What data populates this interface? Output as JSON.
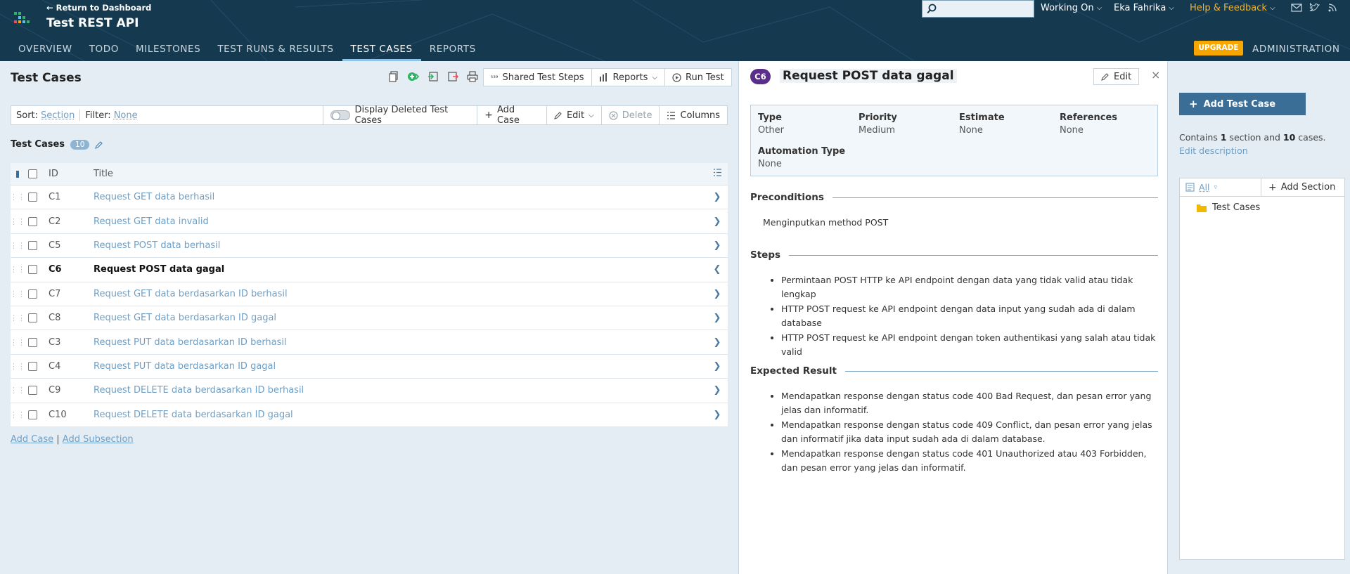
{
  "header": {
    "back_link": "← Return to Dashboard",
    "project_title": "Test REST API",
    "tabs": [
      "OVERVIEW",
      "TODO",
      "MILESTONES",
      "TEST RUNS & RESULTS",
      "TEST CASES",
      "REPORTS"
    ],
    "active_tab": "TEST CASES",
    "search_placeholder": "",
    "working_on": "Working On",
    "user_name": "Eka Fahrika",
    "help_label": "Help & Feedback",
    "upgrade_label": "UPGRADE",
    "admin_label": "ADMINISTRATION",
    "colors": {
      "header_bg": "#153a50",
      "help": "#f2b230",
      "upgrade": "#f7a600"
    }
  },
  "left": {
    "page_title": "Test Cases",
    "toolbar": {
      "shared_steps": "Shared Test Steps",
      "reports": "Reports",
      "run_test": "Run Test"
    },
    "filterbar": {
      "sort_label": "Sort:",
      "sort_value": "Section",
      "filter_label": "Filter:",
      "filter_value": "None",
      "display_deleted": "Display Deleted Test Cases",
      "add_case": "Add Case",
      "edit": "Edit",
      "delete": "Delete",
      "columns": "Columns"
    },
    "section": {
      "name": "Test Cases",
      "count": "10"
    },
    "table": {
      "col_id": "ID",
      "col_title": "Title",
      "rows": [
        {
          "id": "C1",
          "title": "Request GET data berhasil"
        },
        {
          "id": "C2",
          "title": "Request GET data invalid"
        },
        {
          "id": "C5",
          "title": "Request POST data berhasil"
        },
        {
          "id": "C6",
          "title": "Request POST data gagal",
          "selected": true
        },
        {
          "id": "C7",
          "title": "Request GET data berdasarkan ID berhasil"
        },
        {
          "id": "C8",
          "title": "Request GET data berdasarkan ID gagal"
        },
        {
          "id": "C3",
          "title": "Request PUT data berdasarkan ID berhasil"
        },
        {
          "id": "C4",
          "title": "Request PUT data berdasarkan ID gagal"
        },
        {
          "id": "C9",
          "title": "Request DELETE data berdasarkan ID berhasil"
        },
        {
          "id": "C10",
          "title": "Request DELETE data berdasarkan ID gagal"
        }
      ]
    },
    "add_case_link": "Add Case",
    "link_separator": " | ",
    "add_subsection_link": "Add Subsection"
  },
  "detail": {
    "case_id": "C6",
    "case_title": "Request POST data gagal",
    "edit_label": "Edit",
    "close": "×",
    "props": {
      "type_label": "Type",
      "type_value": "Other",
      "priority_label": "Priority",
      "priority_value": "Medium",
      "estimate_label": "Estimate",
      "estimate_value": "None",
      "references_label": "References",
      "references_value": "None",
      "automation_label": "Automation Type",
      "automation_value": "None"
    },
    "preconditions_label": "Preconditions",
    "preconditions_text": "Menginputkan method POST",
    "steps_label": "Steps",
    "steps": [
      "Permintaan POST HTTP ke API endpoint dengan data yang tidak valid atau tidak lengkap",
      "HTTP POST request ke API endpoint dengan data input yang sudah ada di dalam database",
      "HTTP POST request ke API endpoint dengan token authentikasi yang salah atau tidak valid"
    ],
    "expected_label": "Expected Result",
    "expected": [
      "Mendapatkan response dengan status code 400 Bad Request, dan pesan error yang jelas dan informatif.",
      "Mendapatkan response dengan status code 409 Conflict, dan pesan error yang jelas dan informatif jika data input sudah ada di dalam database.",
      "Mendapatkan response dengan status code 401 Unauthorized atau 403 Forbidden, dan pesan error yang jelas dan informatif."
    ]
  },
  "right": {
    "add_test_case": "Add Test Case",
    "contains_prefix": "Contains ",
    "section_count": "1",
    "contains_mid": " section and ",
    "case_count": "10",
    "contains_suffix": " cases. ",
    "edit_description": "Edit description",
    "tree_all": "All",
    "add_section": "Add Section",
    "tree_node": "Test Cases"
  }
}
